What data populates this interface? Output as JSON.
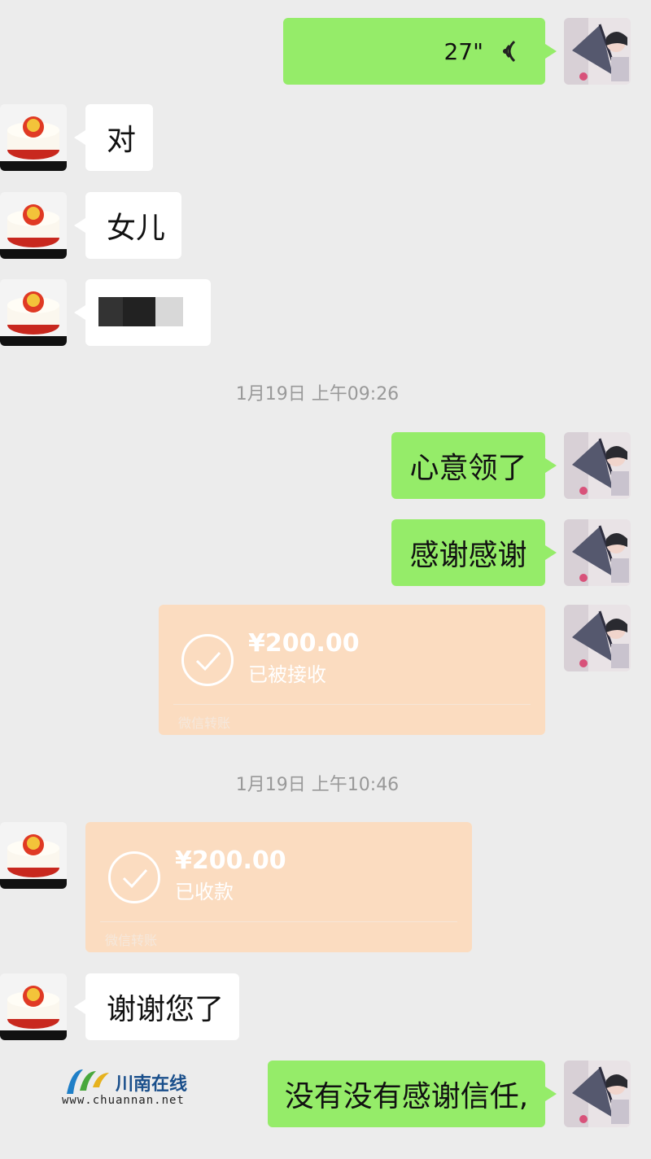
{
  "messages": {
    "voice": {
      "duration": "27\""
    },
    "dui": "对",
    "nuer": "女儿",
    "xinyi": "心意领了",
    "ganxie": "感谢感谢",
    "xiexie_nin": "谢谢您了",
    "last": "没有没有感谢信任,"
  },
  "timestamps": [
    "1月19日 上午09:26",
    "1月19日 上午10:46"
  ],
  "transfers": [
    {
      "amount": "¥200.00",
      "status": "已被接收",
      "source": "微信转账"
    },
    {
      "amount": "¥200.00",
      "status": "已收款",
      "source": "微信转账"
    }
  ],
  "watermark": {
    "name": "川南在线",
    "url": "www.chuannan.net"
  },
  "colors": {
    "outgoing_bubble": "#95ec69",
    "incoming_bubble": "#ffffff",
    "transfer_card": "#fbdcc0",
    "background": "#ececec"
  }
}
